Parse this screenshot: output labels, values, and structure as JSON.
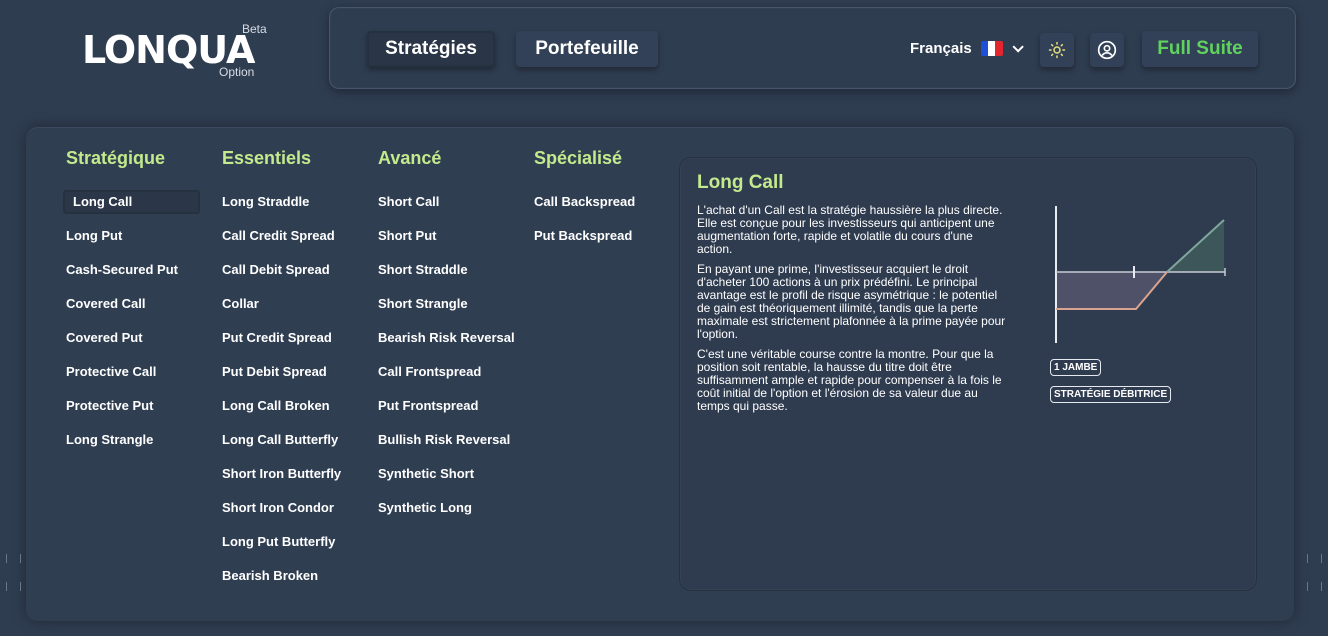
{
  "brand": {
    "name": "LONQUA",
    "beta": "Beta",
    "sub": "Option"
  },
  "header": {
    "nav": [
      {
        "label": "Stratégies",
        "active": true
      },
      {
        "label": "Portefeuille",
        "active": false
      }
    ],
    "language": "Français",
    "theme_icon": "sun-icon",
    "user_icon": "user-circle-icon",
    "full_suite": "Full Suite"
  },
  "colors": {
    "accent_green": "#c3ea8c",
    "cta_green": "#5fd35d",
    "background": "#2f3d51"
  },
  "columns": [
    {
      "title": "Stratégique",
      "items": [
        "Long Call",
        "Long Put",
        "Cash-Secured Put",
        "Covered Call",
        "Covered Put",
        "Protective Call",
        "Protective Put",
        "Long Strangle"
      ]
    },
    {
      "title": "Essentiels",
      "items": [
        "Long Straddle",
        "Call Credit Spread",
        "Call Debit Spread",
        "Collar",
        "Put Credit Spread",
        "Put Debit Spread",
        "Long Call Broken",
        "Long Call Butterfly",
        "Short Iron Butterfly",
        "Short Iron Condor",
        "Long Put Butterfly",
        "Bearish Broken"
      ]
    },
    {
      "title": "Avancé",
      "items": [
        "Short Call",
        "Short Put",
        "Short Straddle",
        "Short Strangle",
        "Bearish Risk Reversal",
        "Call Frontspread",
        "Put Frontspread",
        "Bullish Risk Reversal",
        "Synthetic Short",
        "Synthetic Long"
      ]
    },
    {
      "title": "Spécialisé",
      "items": [
        "Call Backspread",
        "Put Backspread"
      ]
    }
  ],
  "selected": "Long Call",
  "detail": {
    "title": "Long Call",
    "paragraphs": [
      "L'achat d'un Call est la stratégie haussière la plus directe. Elle est conçue pour les investisseurs qui anticipent une augmentation forte, rapide et volatile du cours d'une action.",
      "En payant une prime, l'investisseur acquiert le droit d'acheter 100 actions à un prix prédéfini. Le principal avantage est le profil de risque asymétrique : le potentiel de gain est théoriquement illimité, tandis que la perte maximale est strictement plafonnée à la prime payée pour l'option.",
      "C'est une véritable course contre la montre. Pour que la position soit rentable, la hausse du titre doit être suffisamment ample et rapide pour compenser à la fois le coût initial de l'option et l'érosion de sa valeur due au temps qui passe."
    ],
    "badges": [
      "1 JAMBE",
      "STRATÉGIE DÉBITRICE"
    ]
  }
}
